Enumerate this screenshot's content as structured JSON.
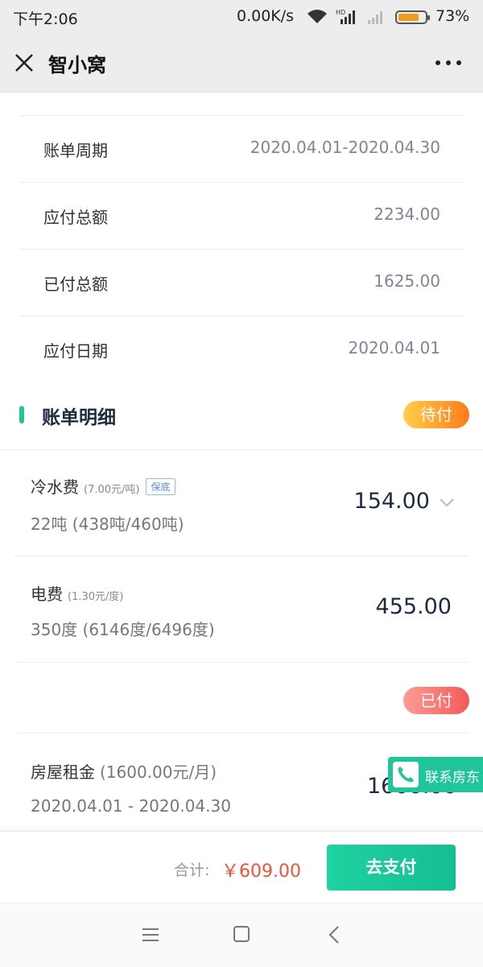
{
  "status_bar": {
    "time": "下午2:06",
    "network_speed": "0.00K/s",
    "battery_percent": "73%",
    "battery_level": 0.73,
    "icons": [
      "wifi-icon",
      "hd-signal-icon",
      "signal-icon",
      "battery-icon"
    ]
  },
  "header": {
    "title": "智小窝",
    "left_icon": "close-icon",
    "right_icon": "more-icon"
  },
  "bill_info": [
    {
      "label": "账单周期",
      "value": "2020.04.01-2020.04.30"
    },
    {
      "label": "应付总额",
      "value": "2234.00"
    },
    {
      "label": "已付总额",
      "value": "1625.00"
    },
    {
      "label": "应付日期",
      "value": "2020.04.01"
    }
  ],
  "details": {
    "title": "账单明细",
    "pending_badge": "待付",
    "paid_badge": "已付",
    "pending_items": [
      {
        "name": "冷水费",
        "rate": "(7.00元/吨)",
        "tag": "保底",
        "usage": "22吨 (438吨/460吨)",
        "amount": "154.00"
      },
      {
        "name": "电费",
        "rate": "(1.30元/度)",
        "usage": "350度 (6146度/6496度)",
        "amount": "455.00"
      }
    ],
    "paid_items": [
      {
        "name": "房屋租金",
        "rate": "(1600.00元/月)",
        "period": "2020.04.01 - 2020.04.30",
        "amount": "1600.00"
      }
    ]
  },
  "contact": {
    "label": "联系房东"
  },
  "pay_bar": {
    "total_label": "合计:",
    "total_value": "￥609.00",
    "pay_button": "去支付"
  },
  "colors": {
    "accent": "#20c59b",
    "price": "#f0513b",
    "pending_badge": "#ff9a2e",
    "paid_badge": "#f4686a"
  }
}
